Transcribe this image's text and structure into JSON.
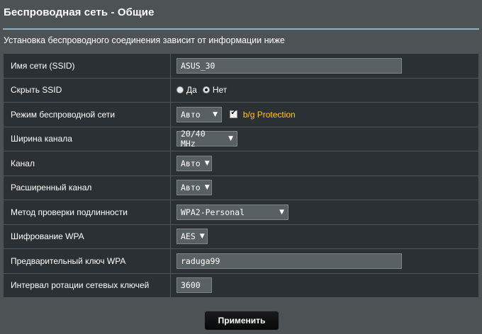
{
  "page": {
    "title": "Беспроводная сеть - Общие",
    "subtitle": "Установка беспроводного соединения зависит от информации ниже"
  },
  "rows": {
    "ssid": {
      "label": "Имя сети (SSID)",
      "value": "ASUS_30"
    },
    "hide_ssid": {
      "label": "Скрыть SSID",
      "option_yes": "Да",
      "option_no": "Нет",
      "selected": "Нет"
    },
    "wireless_mode": {
      "label": "Режим беспроводной сети",
      "value": "Авто",
      "bg_protection_label": "b/g Protection",
      "bg_protection_checked": true
    },
    "channel_width": {
      "label": "Ширина канала",
      "value": "20/40 MHz"
    },
    "channel": {
      "label": "Канал",
      "value": "Авто"
    },
    "ext_channel": {
      "label": "Расширенный канал",
      "value": "Авто"
    },
    "auth_method": {
      "label": "Метод проверки подлинности",
      "value": "WPA2-Personal"
    },
    "wpa_encryption": {
      "label": "Шифрование WPA",
      "value": "AES"
    },
    "wpa_key": {
      "label": "Предварительный ключ WPA",
      "value": "raduga99"
    },
    "key_rotation": {
      "label": "Интервал ротации сетевых ключей",
      "value": "3600"
    }
  },
  "actions": {
    "apply_label": "Применить"
  },
  "colors": {
    "accent_yellow": "#ffc626",
    "table_bg": "#2a3033",
    "page_bg": "#4d5254",
    "separator": "#8fb1c4"
  }
}
